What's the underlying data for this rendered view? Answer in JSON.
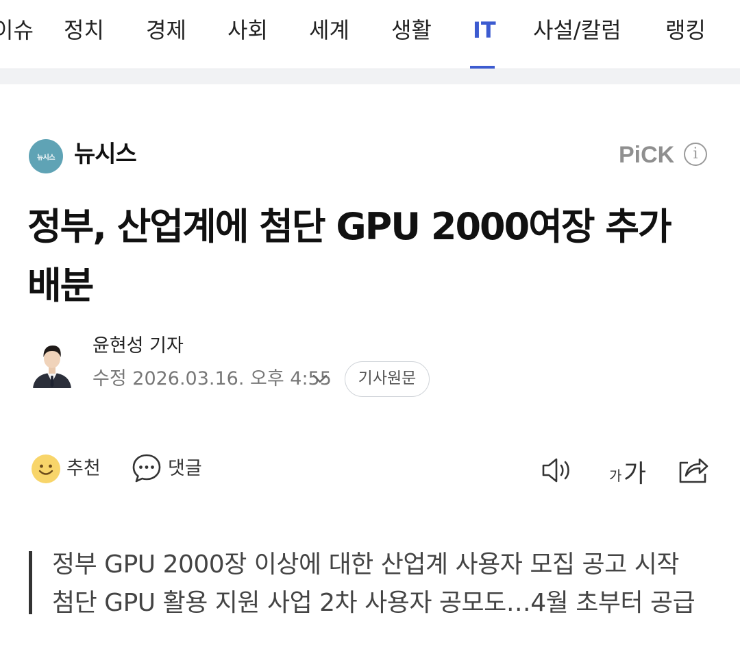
{
  "nav": {
    "items": [
      {
        "label": "이슈",
        "active": false
      },
      {
        "label": "정치",
        "active": false
      },
      {
        "label": "경제",
        "active": false
      },
      {
        "label": "사회",
        "active": false
      },
      {
        "label": "세계",
        "active": false
      },
      {
        "label": "생활",
        "active": false
      },
      {
        "label": "IT",
        "active": true
      },
      {
        "label": "사설/칼럼",
        "active": false
      },
      {
        "label": "랭킹",
        "active": false
      }
    ],
    "accent_color": "#3c5bd0"
  },
  "press": {
    "logo_text": "뉴시스",
    "name": "뉴시스",
    "pick_label": "PiCK",
    "info_icon": "info-icon"
  },
  "article": {
    "title": "정부, 산업계에 첨단 GPU 2000여장 추가 배분",
    "reporter": "윤현성 기자",
    "datetime": "수정 2026.03.16. 오후 4:55",
    "original_button": "기사원문"
  },
  "actions": {
    "like_label": "추천",
    "comment_label": "댓글",
    "font_small": "가",
    "font_large": "가"
  },
  "summary": {
    "lines": [
      "정부 GPU 2000장 이상에 대한 산업계 사용자 모집 공고 시작",
      "첨단 GPU 활용 지원 사업 2차 사용자 공모도…4월 초부터 공급"
    ]
  }
}
